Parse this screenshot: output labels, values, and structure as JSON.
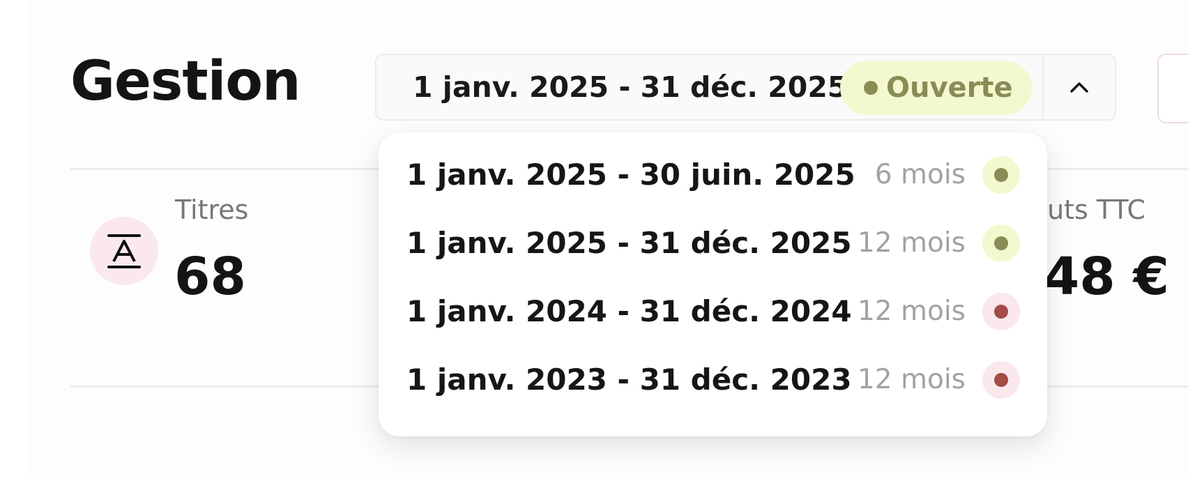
{
  "header": {
    "title": "Gestion",
    "period_selector": {
      "selected": "1 janv. 2025 - 31 déc. 2025",
      "status": "Ouverte",
      "status_color": "#878d55",
      "toggle_icon": "chevron-up-icon"
    }
  },
  "stats": {
    "left": {
      "label": "Titres",
      "value": "68",
      "icon": "text-a-icon"
    },
    "right": {
      "label": "uts TTC",
      "value": "48 €"
    }
  },
  "dropdown": {
    "items": [
      {
        "period": "1 janv. 2025 - 30 juin. 2025",
        "duration": "6 mois",
        "state": "open"
      },
      {
        "period": "1 janv. 2025 - 31 déc. 2025",
        "duration": "12 mois",
        "state": "open"
      },
      {
        "period": "1 janv. 2024 - 31 déc. 2024",
        "duration": "12 mois",
        "state": "closed"
      },
      {
        "period": "1 janv. 2023 - 31 déc. 2023",
        "duration": "12 mois",
        "state": "closed"
      }
    ],
    "colors": {
      "open": "#878d55",
      "closed": "#a54b48"
    }
  }
}
